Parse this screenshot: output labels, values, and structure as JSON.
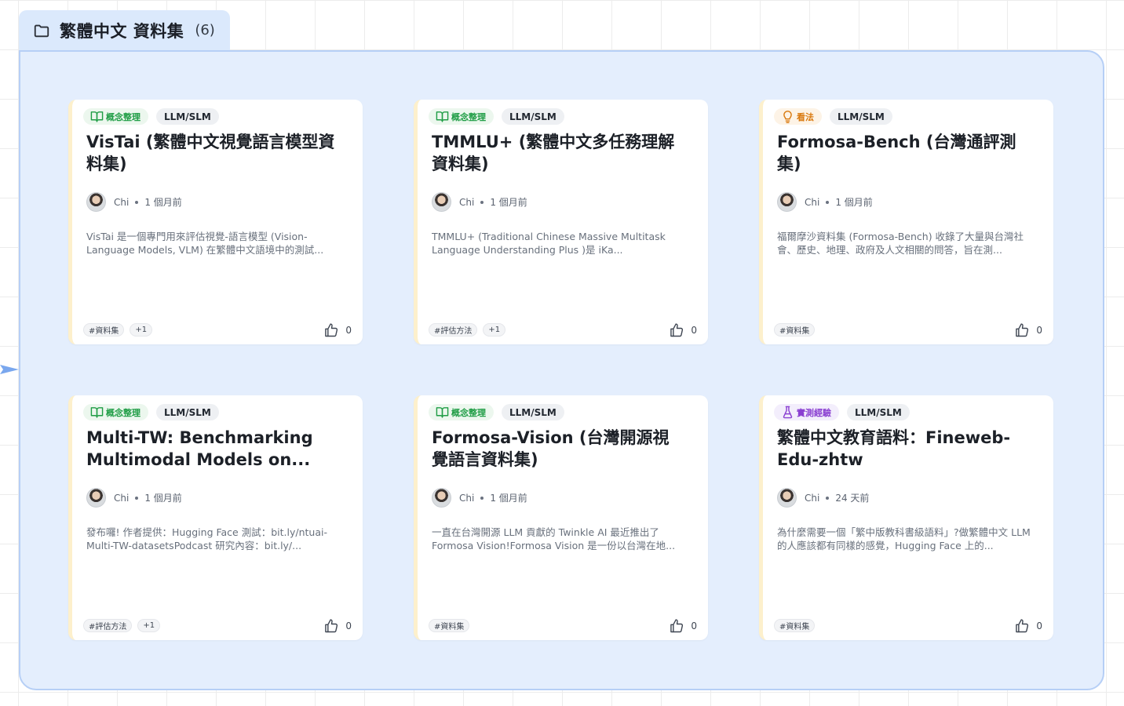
{
  "group": {
    "title": "繁體中文 資料集",
    "count": "(6)",
    "folder_icon": "folder-icon",
    "accent": "#dbe9fc"
  },
  "cards": [
    {
      "category": "概念整理",
      "category_icon": "book-icon",
      "category_color": "#1f9d45",
      "type": "LLM/SLM",
      "title": "VisTai (繁體中文視覺語言模型資料集)",
      "author": "Chi",
      "time": "1 個月前",
      "summary": "VisTai 是一個專門用來評估視覺-語言模型 (Vision-Language Models, VLM) 在繁體中文語境中的測試...",
      "hashtags": [
        "#資料集",
        "+1"
      ],
      "likes": "0"
    },
    {
      "category": "概念整理",
      "category_icon": "book-icon",
      "category_color": "#1f9d45",
      "type": "LLM/SLM",
      "title": "TMMLU+ (繁體中文多任務理解資料集)",
      "author": "Chi",
      "time": "1 個月前",
      "summary": "TMMLU+ (Traditional Chinese Massive Multitask Language Understanding Plus )是 iKa...",
      "hashtags": [
        "#評估方法",
        "+1"
      ],
      "likes": "0"
    },
    {
      "category": "看法",
      "category_icon": "lightbulb-icon",
      "category_color": "#d9780c",
      "type": "LLM/SLM",
      "title": "Formosa-Bench (台灣通評測集)",
      "author": "Chi",
      "time": "1 個月前",
      "summary": "福爾摩沙資料集 (Formosa-Bench) 收錄了大量與台灣社會、歷史、地理、政府及人文相關的問答，旨在測...",
      "hashtags": [
        "#資料集"
      ],
      "likes": "0"
    },
    {
      "category": "概念整理",
      "category_icon": "book-icon",
      "category_color": "#1f9d45",
      "type": "LLM/SLM",
      "title": "Multi-TW: Benchmarking Multimodal Models on...",
      "author": "Chi",
      "time": "1 個月前",
      "summary": "發布囉! 作者提供：Hugging Face 測試：bit.ly/ntuai-Multi-TW-datasetsPodcast 研究內容：bit.ly/...",
      "hashtags": [
        "#評估方法",
        "+1"
      ],
      "likes": "0"
    },
    {
      "category": "概念整理",
      "category_icon": "book-icon",
      "category_color": "#1f9d45",
      "type": "LLM/SLM",
      "title": "Formosa-Vision (台灣開源視覺語言資料集)",
      "author": "Chi",
      "time": "1 個月前",
      "summary": "一直在台灣開源 LLM 貢獻的 Twinkle AI 最近推出了 Formosa Vision!Formosa Vision 是一份以台灣在地...",
      "hashtags": [
        "#資料集"
      ],
      "likes": "0"
    },
    {
      "category": "實測經驗",
      "category_icon": "flask-icon",
      "category_color": "#8a3fd1",
      "type": "LLM/SLM",
      "title": "繁體中文教育語料：Fineweb-Edu-zhtw",
      "author": "Chi",
      "time": "24 天前",
      "summary": "為什麼需要一個「繁中版教科書級語料」?做繁體中文 LLM 的人應該都有同樣的感覺，Hugging Face 上的...",
      "hashtags": [
        "#資料集"
      ],
      "likes": "0"
    }
  ]
}
